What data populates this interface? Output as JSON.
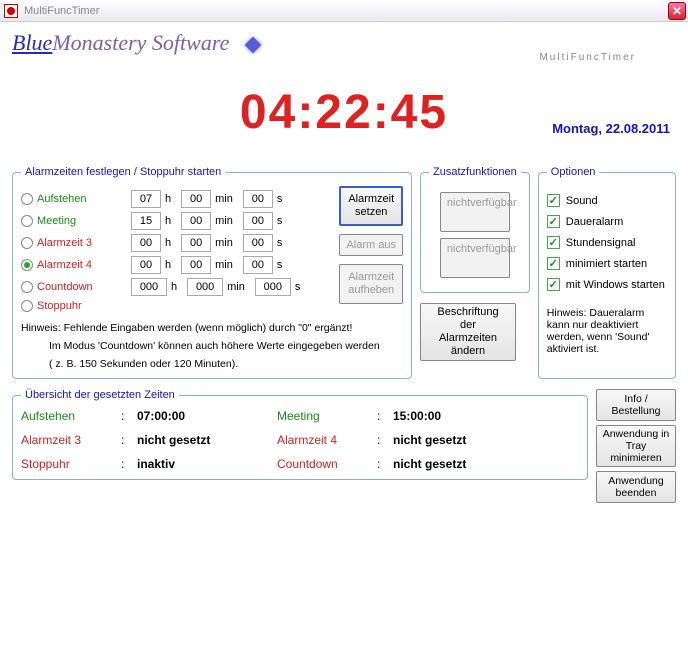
{
  "window": {
    "title": "MultiFuncTimer"
  },
  "logo": {
    "blue": "Blue",
    "rest": "Monastery Software",
    "sub": "MultiFuncTimer"
  },
  "clock": "04:22:45",
  "date": "Montag, 22.08.2011",
  "alarms": {
    "legend": "Alarmzeiten festlegen / Stoppuhr starten",
    "rows": [
      {
        "label": "Aufstehen",
        "cls": "green",
        "h": "07",
        "m": "00",
        "s": "00",
        "checked": false
      },
      {
        "label": "Meeting",
        "cls": "green",
        "h": "15",
        "m": "00",
        "s": "00",
        "checked": false
      },
      {
        "label": "Alarmzeit 3",
        "cls": "red",
        "h": "00",
        "m": "00",
        "s": "00",
        "checked": false
      },
      {
        "label": "Alarmzeit 4",
        "cls": "red",
        "h": "00",
        "m": "00",
        "s": "00",
        "checked": true
      },
      {
        "label": "Countdown",
        "cls": "red",
        "h": "000",
        "m": "000",
        "s": "000",
        "checked": false,
        "wide": true
      },
      {
        "label": "Stoppuhr",
        "cls": "red",
        "notime": true,
        "checked": false
      }
    ],
    "btn_set1": "Alarmzeit",
    "btn_set2": "setzen",
    "btn_off": "Alarm aus",
    "btn_lift1": "Alarmzeit",
    "btn_lift2": "aufheben",
    "hint1": "Hinweis: Fehlende Eingaben werden (wenn möglich) durch \"0\" ergänzt!",
    "hint2": "Im Modus 'Countdown' können auch höhere Werte eingegeben werden",
    "hint3": "( z. B. 150 Sekunden oder 120 Minuten).",
    "unit_h": "h",
    "unit_m": "min",
    "unit_s": "s"
  },
  "zusatz": {
    "legend": "Zusatzfunktionen",
    "na1": "nicht",
    "na2": "verfügbar",
    "beschriftung1": "Beschriftung",
    "beschriftung2": "der",
    "beschriftung3": "Alarmzeiten",
    "beschriftung4": "ändern"
  },
  "options": {
    "legend": "Optionen",
    "items": [
      {
        "label": "Sound",
        "checked": true
      },
      {
        "label": "Daueralarm",
        "checked": true
      },
      {
        "label": "Stundensignal",
        "checked": true
      },
      {
        "label": "minimiert starten",
        "checked": true
      },
      {
        "label": "mit Windows starten",
        "checked": true
      }
    ],
    "hint": "Hinweis: Daueralarm kann nur deaktiviert werden, wenn 'Sound' aktiviert ist."
  },
  "overview": {
    "legend": "Übersicht der gesetzten Zeiten",
    "rows": [
      [
        "Aufstehen",
        "green",
        "07:00:00",
        "Meeting",
        "green",
        "15:00:00"
      ],
      [
        "Alarmzeit 3",
        "red",
        "nicht gesetzt",
        "Alarmzeit 4",
        "red",
        "nicht gesetzt"
      ],
      [
        "Stoppuhr",
        "red",
        "inaktiv",
        "Countdown",
        "red",
        "nicht gesetzt"
      ]
    ]
  },
  "right_buttons": {
    "info1": "Info /",
    "info2": "Bestellung",
    "tray1": "Anwendung in",
    "tray2": "Tray",
    "tray3": "minimieren",
    "exit1": "Anwendung",
    "exit2": "beenden"
  }
}
